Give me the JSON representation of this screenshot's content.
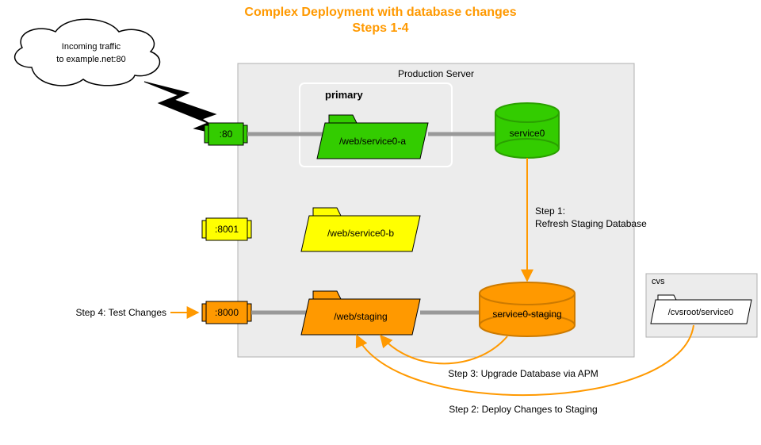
{
  "title_line1": "Complex Deployment with database changes",
  "title_line2": "Steps 1-4",
  "cloud_line1": "Incoming traffic",
  "cloud_line2": "to example.net:80",
  "prod_server_label": "Production Server",
  "primary_label": "primary",
  "port80": ":80",
  "port8001": ":8001",
  "port8000": ":8000",
  "folder_a": "/web/service0-a",
  "folder_b": "/web/service0-b",
  "folder_staging": "/web/staging",
  "db_service0": "service0",
  "db_staging": "service0-staging",
  "cvs_label": "cvs",
  "cvs_folder": "/cvsroot/service0",
  "step1_line1": "Step 1:",
  "step1_line2": "Refresh Staging Database",
  "step2": "Step 2: Deploy Changes to Staging",
  "step3": "Step 3: Upgrade Database via APM",
  "step4": "Step 4: Test Changes",
  "colors": {
    "orange": "#ff9900",
    "green_fill": "#33cc00",
    "green_stroke": "#2aa000",
    "yellow": "#ffff00",
    "orange_fill": "#ff9900",
    "grey_line": "#999999",
    "box_fill": "#ececec",
    "box_stroke": "#b0b0b0"
  }
}
